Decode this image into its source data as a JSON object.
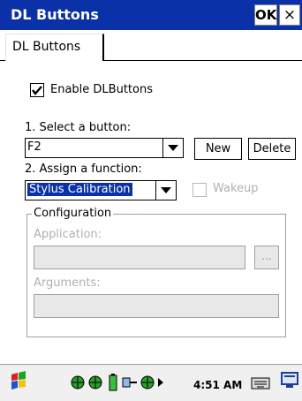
{
  "window": {
    "title": "DL Buttons",
    "ok_label": "OK",
    "close_glyph": "×"
  },
  "tab": {
    "label": "DL Buttons"
  },
  "enable": {
    "label": "Enable DLButtons",
    "checked": true
  },
  "select_button": {
    "label": "1. Select a button:",
    "value": "F2",
    "new_label": "New",
    "delete_label": "Delete"
  },
  "assign_function": {
    "label": "2. Assign a function:",
    "value": "Stylus Calibration",
    "wakeup_label": "Wakeup"
  },
  "configuration": {
    "legend": "Configuration",
    "application_label": "Application:",
    "browse_label": "...",
    "arguments_label": "Arguments:"
  },
  "taskbar": {
    "time": "4:51 AM",
    "icons": [
      "start-flag-icon",
      "network-globe-icon",
      "network-globe-icon",
      "battery-icon",
      "usb-connection-icon",
      "network-globe-icon",
      "tray-expand-icon",
      "keyboard-icon",
      "display-icon"
    ]
  },
  "colors": {
    "title_bar": "#0a31a8",
    "selection": "#0a31a8"
  }
}
